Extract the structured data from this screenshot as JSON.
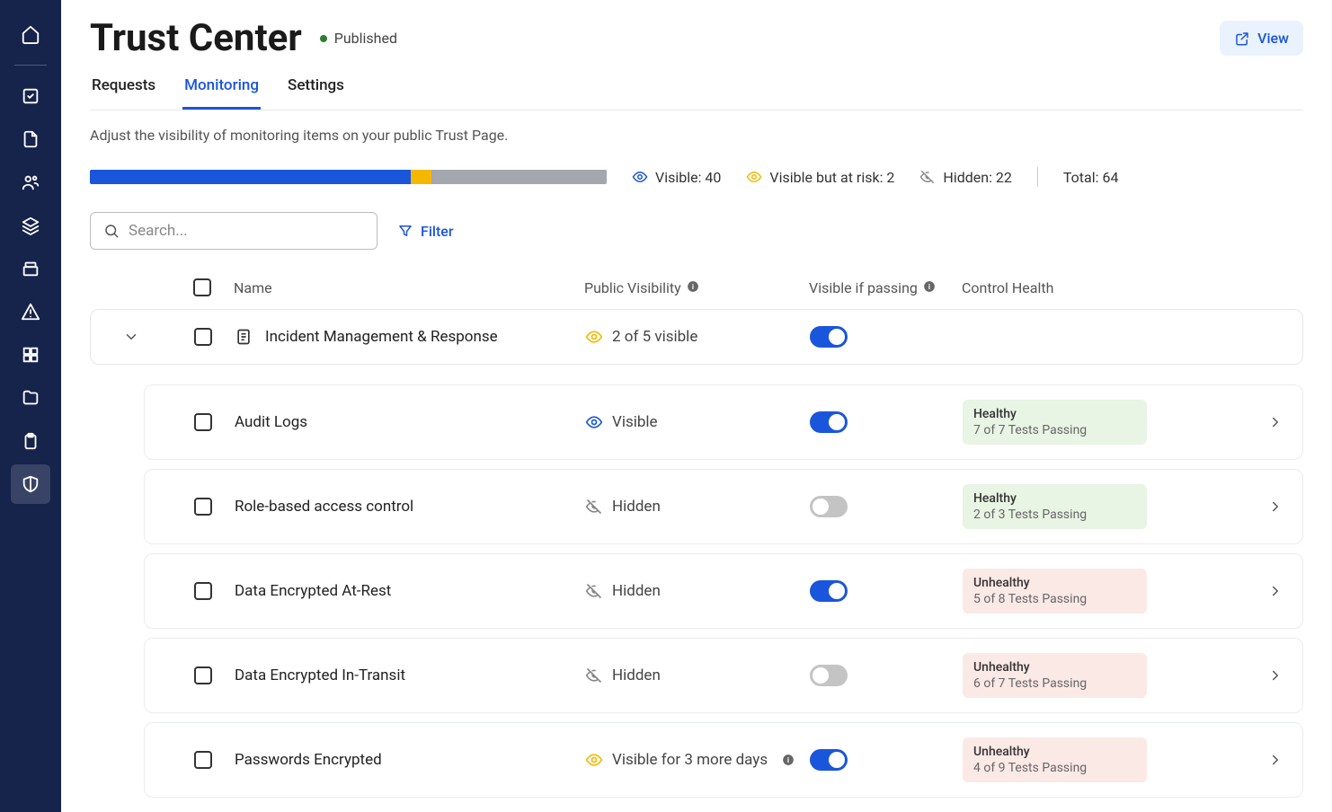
{
  "header": {
    "title": "Trust Center",
    "status": "Published",
    "view_btn": "View"
  },
  "tabs": {
    "requests": "Requests",
    "monitoring": "Monitoring",
    "settings": "Settings"
  },
  "description": "Adjust the visibility of monitoring items on your public Trust Page.",
  "stats": {
    "visible": "Visible: 40",
    "at_risk": "Visible but at risk: 2",
    "hidden": "Hidden: 22",
    "total": "Total: 64"
  },
  "bar": {
    "visible_pct": 62,
    "at_risk_pct": 4,
    "hidden_pct": 34,
    "visible_color": "#1a56db",
    "at_risk_color": "#f5b800",
    "hidden_color": "#a4a7ae"
  },
  "toolbar": {
    "search_placeholder": "Search...",
    "filter": "Filter"
  },
  "columns": {
    "name": "Name",
    "public_visibility": "Public Visibility",
    "visible_if_passing": "Visible if passing",
    "control_health": "Control Health"
  },
  "group": {
    "name": "Incident Management & Response",
    "visibility": "2 of 5 visible",
    "toggle": true
  },
  "rows": [
    {
      "name": "Audit Logs",
      "visibility": "Visible",
      "vis_icon": "eye-blue",
      "toggle": true,
      "health": "healthy",
      "health_title": "Healthy",
      "health_sub": "7 of 7 Tests Passing"
    },
    {
      "name": "Role-based access control",
      "visibility": "Hidden",
      "vis_icon": "eye-gray",
      "toggle": false,
      "health": "healthy",
      "health_title": "Healthy",
      "health_sub": "2 of 3 Tests Passing"
    },
    {
      "name": "Data Encrypted At-Rest",
      "visibility": "Hidden",
      "vis_icon": "eye-gray",
      "toggle": true,
      "health": "unhealthy",
      "health_title": "Unhealthy",
      "health_sub": "5 of 8 Tests Passing"
    },
    {
      "name": "Data Encrypted In-Transit",
      "visibility": "Hidden",
      "vis_icon": "eye-gray",
      "toggle": false,
      "health": "unhealthy",
      "health_title": "Unhealthy",
      "health_sub": "6 of 7 Tests Passing"
    },
    {
      "name": "Passwords Encrypted",
      "visibility": "Visible for 3 more days",
      "vis_icon": "eye-amber",
      "toggle": true,
      "health": "unhealthy",
      "health_title": "Unhealthy",
      "health_sub": "4 of 9 Tests Passing",
      "info": true
    }
  ],
  "colors": {
    "blue": "#1a56db",
    "amber": "#f5b800",
    "gray": "#888"
  }
}
